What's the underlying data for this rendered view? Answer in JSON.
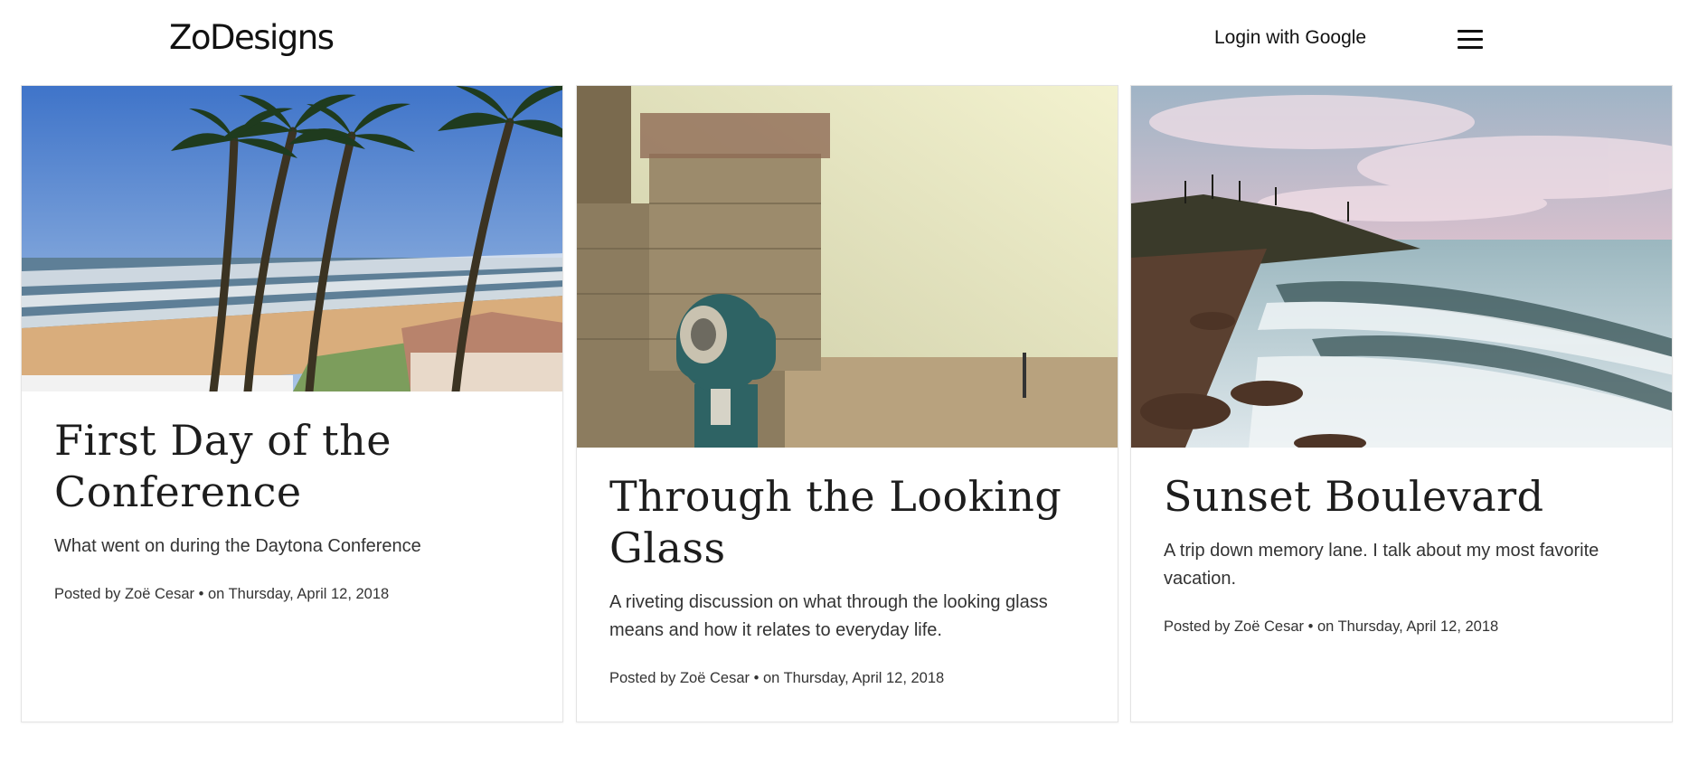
{
  "header": {
    "logo": "ZoDesigns",
    "login_label": "Login with Google",
    "menu_icon": "hamburger-menu-icon"
  },
  "posts": [
    {
      "title": "First Day of the Conference",
      "description": "What went on during the Daytona Conference",
      "meta": "Posted by Zoë Cesar • on Thursday, April 12, 2018",
      "image": "beach-palm-trees-photo"
    },
    {
      "title": "Through the Looking Glass",
      "description": "A riveting discussion on what through the looking glass means and how it relates to everyday life.",
      "meta": "Posted by Zoë Cesar • on Thursday, April 12, 2018",
      "image": "lighthouse-binocular-viewer-photo"
    },
    {
      "title": "Sunset Boulevard",
      "description": "A trip down memory lane. I talk about my most favorite vacation.",
      "meta": "Posted by Zoë Cesar • on Thursday, April 12, 2018",
      "image": "coastal-waves-sunset-photo"
    }
  ],
  "colors": {
    "text": "#1d1d1d",
    "border": "#e4e4e4",
    "background": "#ffffff"
  }
}
